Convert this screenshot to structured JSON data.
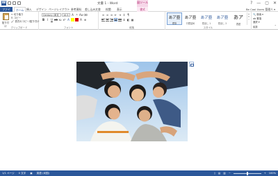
{
  "app": {
    "title": "文書 1 - Word",
    "context_tab_header": "図ツール",
    "window_controls": [
      "?",
      "—",
      "▢",
      "✕"
    ]
  },
  "tabs": [
    "ファイル",
    "ホーム",
    "挿入",
    "デザイン",
    "ページレイアウト",
    "参考資料",
    "差し込み文書",
    "校閲",
    "表示",
    "書式"
  ],
  "user": "Be Cool Users 管理人 ▾",
  "ribbon": {
    "clipboard": {
      "paste": "貼り付け",
      "items": [
        "✂ 切り取り",
        "⎘ コピー",
        "🖌 書式のコピー/貼り付け"
      ],
      "label": "クリップボード"
    },
    "font": {
      "name": "Century (本文",
      "size": "10.5",
      "label": "フォント"
    },
    "paragraph": {
      "label": "段落"
    },
    "styles": {
      "label": "スタイル",
      "items": [
        {
          "preview": "あア亜",
          "name": "標準"
        },
        {
          "preview": "あア亜",
          "name": "行間詰め"
        },
        {
          "preview": "あア亜",
          "name": "見出し 1"
        },
        {
          "preview": "あア亜",
          "name": "見出し 2"
        },
        {
          "preview": "あア",
          "name": "表題"
        }
      ]
    },
    "editing": {
      "items": [
        "🔍 検索 ▾",
        "ab 置換",
        "選択 ▾"
      ],
      "label": "編集"
    }
  },
  "status": {
    "page": "1/1 ページ",
    "words": "0 文字",
    "lang": "英語 (米国)",
    "zoom": "100%"
  },
  "colors": {
    "accent": "#2b579a",
    "context": "#b0236b"
  }
}
